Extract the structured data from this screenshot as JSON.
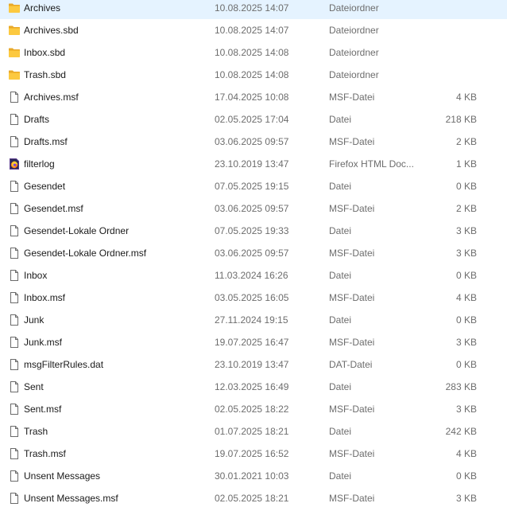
{
  "files": [
    {
      "name": "Archives",
      "date": "10.08.2025 14:07",
      "type": "Dateiordner",
      "size": "",
      "icon": "folder-icon"
    },
    {
      "name": "Archives.sbd",
      "date": "10.08.2025 14:07",
      "type": "Dateiordner",
      "size": "",
      "icon": "folder-icon"
    },
    {
      "name": "Inbox.sbd",
      "date": "10.08.2025 14:08",
      "type": "Dateiordner",
      "size": "",
      "icon": "folder-icon"
    },
    {
      "name": "Trash.sbd",
      "date": "10.08.2025 14:08",
      "type": "Dateiordner",
      "size": "",
      "icon": "folder-icon"
    },
    {
      "name": "Archives.msf",
      "date": "17.04.2025 10:08",
      "type": "MSF-Datei",
      "size": "4 KB",
      "icon": "file-icon"
    },
    {
      "name": "Drafts",
      "date": "02.05.2025 17:04",
      "type": "Datei",
      "size": "218 KB",
      "icon": "file-icon"
    },
    {
      "name": "Drafts.msf",
      "date": "03.06.2025 09:57",
      "type": "MSF-Datei",
      "size": "2 KB",
      "icon": "file-icon"
    },
    {
      "name": "filterlog",
      "date": "23.10.2019 13:47",
      "type": "Firefox HTML Doc...",
      "size": "1 KB",
      "icon": "firefox-document-icon"
    },
    {
      "name": "Gesendet",
      "date": "07.05.2025 19:15",
      "type": "Datei",
      "size": "0 KB",
      "icon": "file-icon"
    },
    {
      "name": "Gesendet.msf",
      "date": "03.06.2025 09:57",
      "type": "MSF-Datei",
      "size": "2 KB",
      "icon": "file-icon"
    },
    {
      "name": "Gesendet-Lokale Ordner",
      "date": "07.05.2025 19:33",
      "type": "Datei",
      "size": "3 KB",
      "icon": "file-icon"
    },
    {
      "name": "Gesendet-Lokale Ordner.msf",
      "date": "03.06.2025 09:57",
      "type": "MSF-Datei",
      "size": "3 KB",
      "icon": "file-icon"
    },
    {
      "name": "Inbox",
      "date": "11.03.2024 16:26",
      "type": "Datei",
      "size": "0 KB",
      "icon": "file-icon"
    },
    {
      "name": "Inbox.msf",
      "date": "03.05.2025 16:05",
      "type": "MSF-Datei",
      "size": "4 KB",
      "icon": "file-icon"
    },
    {
      "name": "Junk",
      "date": "27.11.2024 19:15",
      "type": "Datei",
      "size": "0 KB",
      "icon": "file-icon"
    },
    {
      "name": "Junk.msf",
      "date": "19.07.2025 16:47",
      "type": "MSF-Datei",
      "size": "3 KB",
      "icon": "file-icon"
    },
    {
      "name": "msgFilterRules.dat",
      "date": "23.10.2019 13:47",
      "type": "DAT-Datei",
      "size": "0 KB",
      "icon": "file-icon"
    },
    {
      "name": "Sent",
      "date": "12.03.2025 16:49",
      "type": "Datei",
      "size": "283 KB",
      "icon": "file-icon"
    },
    {
      "name": "Sent.msf",
      "date": "02.05.2025 18:22",
      "type": "MSF-Datei",
      "size": "3 KB",
      "icon": "file-icon"
    },
    {
      "name": "Trash",
      "date": "01.07.2025 18:21",
      "type": "Datei",
      "size": "242 KB",
      "icon": "file-icon"
    },
    {
      "name": "Trash.msf",
      "date": "19.07.2025 16:52",
      "type": "MSF-Datei",
      "size": "4 KB",
      "icon": "file-icon"
    },
    {
      "name": "Unsent Messages",
      "date": "30.01.2021 10:03",
      "type": "Datei",
      "size": "0 KB",
      "icon": "file-icon"
    },
    {
      "name": "Unsent Messages.msf",
      "date": "02.05.2025 18:21",
      "type": "MSF-Datei",
      "size": "3 KB",
      "icon": "file-icon"
    }
  ]
}
